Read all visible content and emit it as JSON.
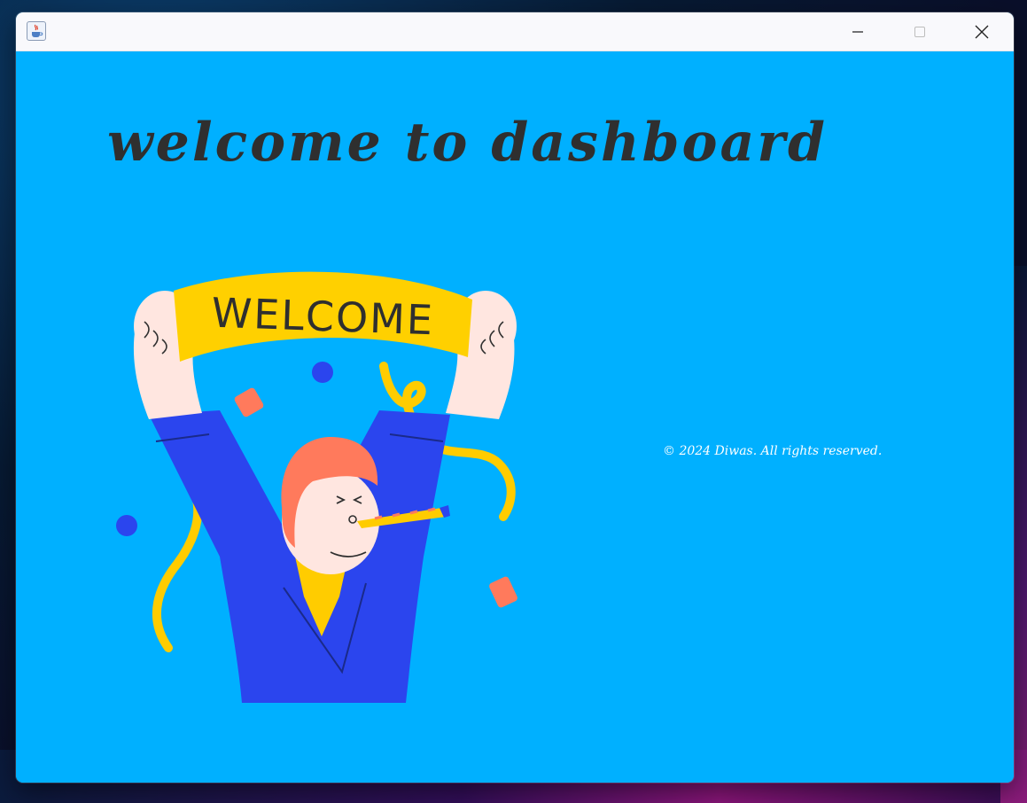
{
  "window": {
    "icon": "java-cup-icon",
    "controls": [
      "minimize-icon",
      "maximize-icon",
      "close-icon"
    ]
  },
  "main": {
    "heading": "welcome to dashboard",
    "banner_text": "WELCOME",
    "footer": "© 2024 Diwas. All rights reserved."
  },
  "colors": {
    "background": "#00b0ff",
    "heading": "#2f2f2f",
    "banner": "#ffd000",
    "jacket": "#2b45ee",
    "hair": "#ff7a5c"
  }
}
